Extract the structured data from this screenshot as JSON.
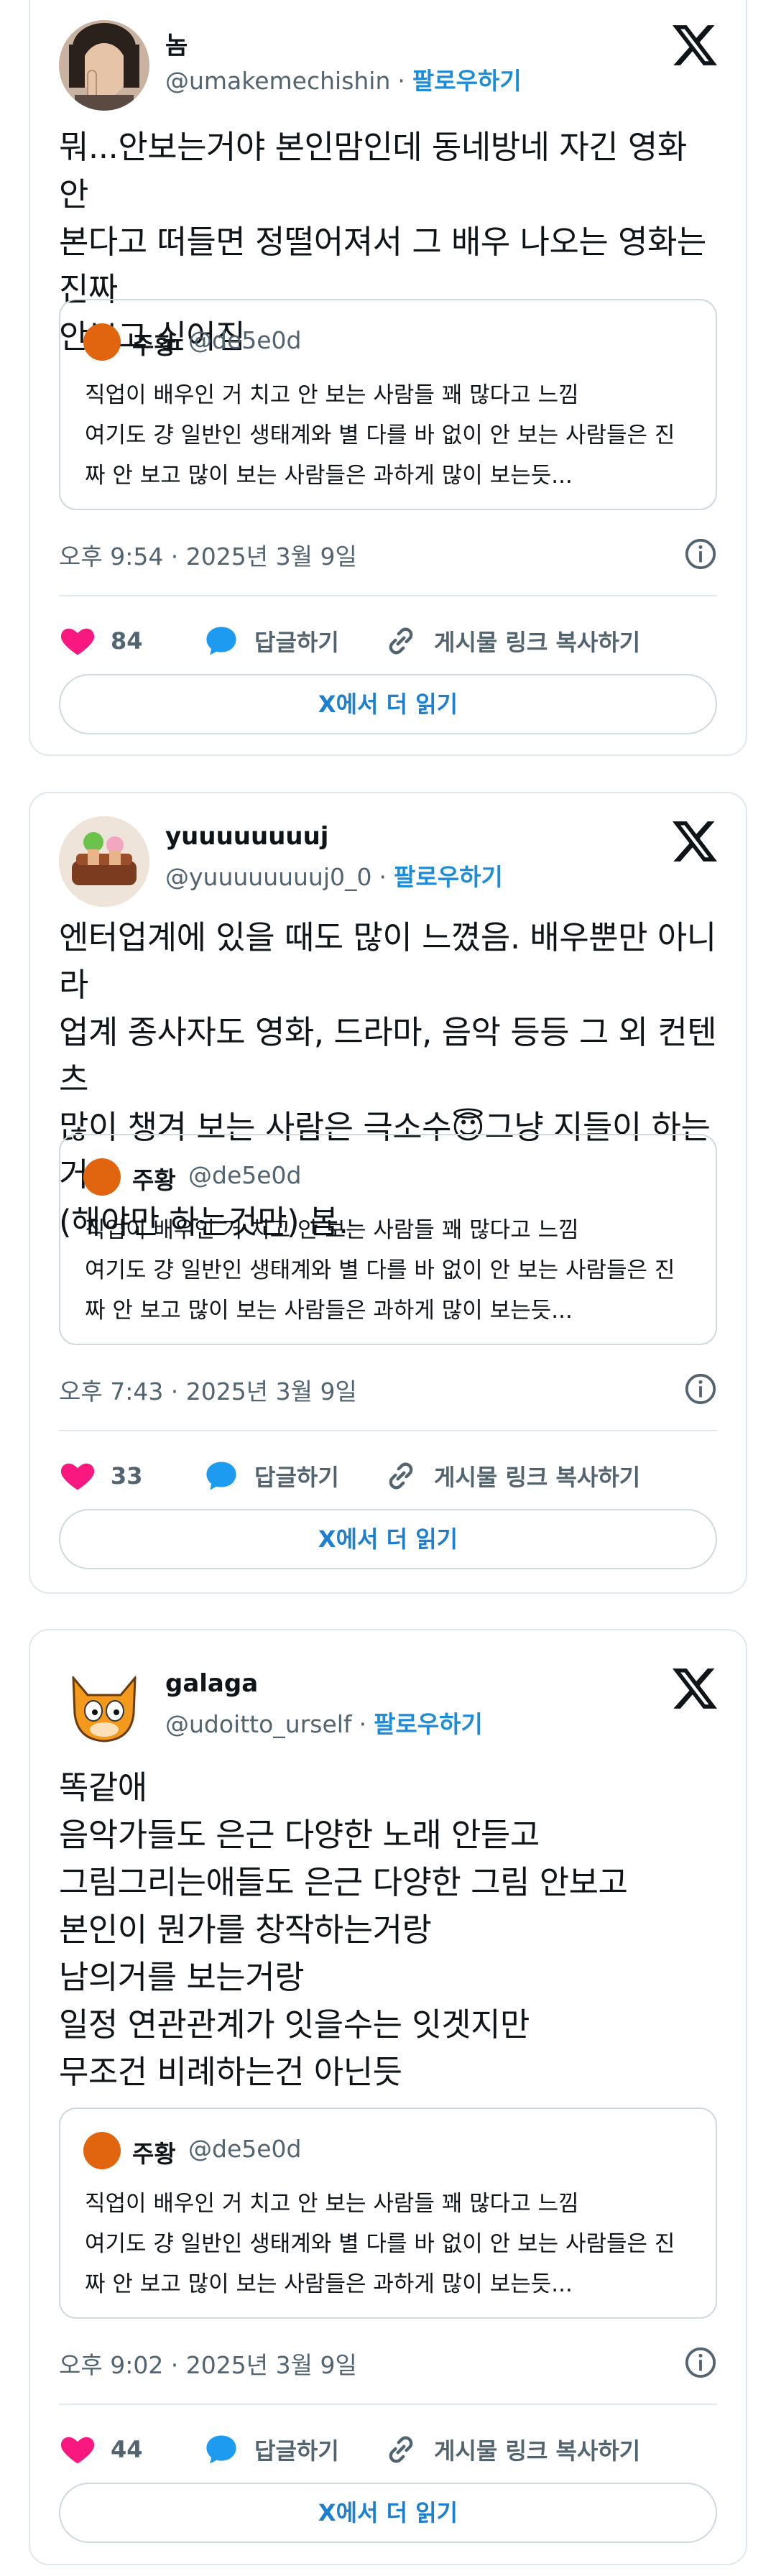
{
  "tweets": [
    {
      "name": "놈",
      "handle": "@umakemechishin",
      "separator": "·",
      "follow_label": "팔로우하기",
      "text": "뭐...안보는거야 본인맘인데 동네방네 자긴 영화 안\n본다고 떠들면 정떨어져서 그 배우 나오는 영화는 진짜\n안보고 싶어짐",
      "quote": {
        "name": "주황",
        "handle": "@de5e0d",
        "text": "직업이 배우인 거 치고 안 보는 사람들 꽤 많다고 느낌\n여기도 걍 일반인 생태계와 별 다를 바 없이 안 보는 사람들은 진\n짜 안 보고 많이 보는 사람들은 과하게 많이 보는듯..."
      },
      "timestamp": "오후 9:54 · 2025년 3월 9일",
      "likes": "84",
      "reply_label": "답글하기",
      "copy_label": "게시물 링크 복사하기",
      "read_more_label": "X에서 더 읽기"
    },
    {
      "name": "yuuuuuuuuj",
      "handle": "@yuuuuuuuuj0_0",
      "separator": "·",
      "follow_label": "팔로우하기",
      "text_before_emoji": "엔터업계에 있을 때도 많이 느꼈음. 배우뿐만 아니라\n업계 종사자도 영화, 드라마, 음악 등등 그 외 컨텐츠\n많이 챙겨 보는 사람은 극소수",
      "emoji": "😇",
      "text_after_emoji": "그냥 지들이 하는 거\n(해야만 하는것만) 봄.",
      "quote": {
        "name": "주황",
        "handle": "@de5e0d",
        "text": "직업이 배우인 거 치고 안 보는 사람들 꽤 많다고 느낌\n여기도 걍 일반인 생태계와 별 다를 바 없이 안 보는 사람들은 진\n짜 안 보고 많이 보는 사람들은 과하게 많이 보는듯..."
      },
      "timestamp": "오후 7:43 · 2025년 3월 9일",
      "likes": "33",
      "reply_label": "답글하기",
      "copy_label": "게시물 링크 복사하기",
      "read_more_label": "X에서 더 읽기"
    },
    {
      "name": "galaga",
      "handle": "@udoitto_urself",
      "separator": "·",
      "follow_label": "팔로우하기",
      "text": "똑같애\n음악가들도 은근 다양한 노래 안듣고\n그림그리는애들도 은근 다양한 그림 안보고\n본인이 뭔가를 창작하는거랑\n남의거를 보는거랑\n일정 연관관계가 잇을수는 잇겟지만\n무조건 비례하는건 아닌듯",
      "quote": {
        "name": "주황",
        "handle": "@de5e0d",
        "text": "직업이 배우인 거 치고 안 보는 사람들 꽤 많다고 느낌\n여기도 걍 일반인 생태계와 별 다를 바 없이 안 보는 사람들은 진\n짜 안 보고 많이 보는 사람들은 과하게 많이 보는듯..."
      },
      "timestamp": "오후 9:02 · 2025년 3월 9일",
      "likes": "44",
      "reply_label": "답글하기",
      "copy_label": "게시물 링크 복사하기",
      "read_more_label": "X에서 더 읽기"
    }
  ],
  "colors": {
    "like": "#f91880",
    "reply": "#1d9bf0",
    "follow": "#1d8cd8",
    "quote_avatar": "#e0650e",
    "border": "#e1e8ed"
  },
  "icons": {
    "logo": "x-logo-icon",
    "info": "info-icon",
    "like": "heart-icon",
    "reply": "speech-bubble-icon",
    "copy": "link-icon"
  }
}
